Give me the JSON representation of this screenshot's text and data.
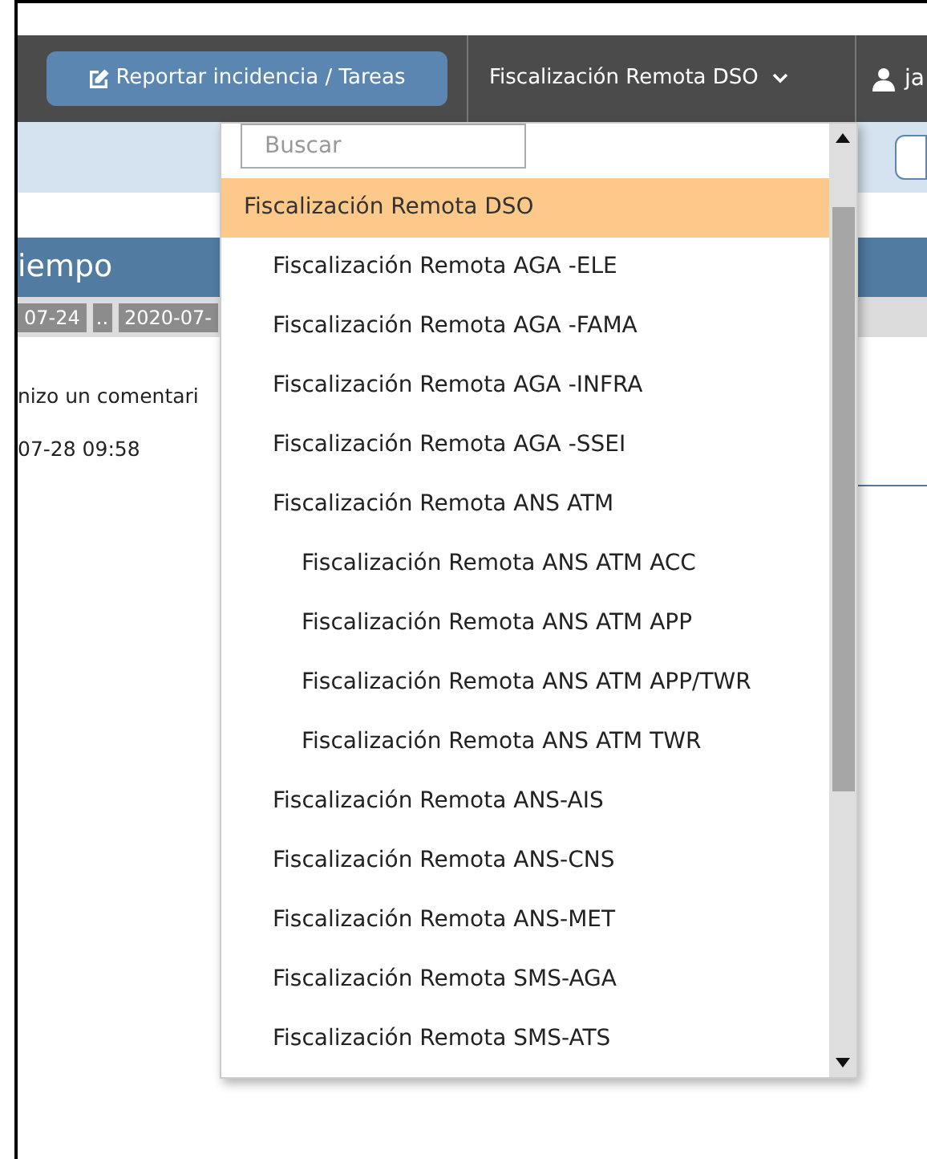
{
  "navbar": {
    "report_button": "Reportar incidencia / Tareas",
    "dropdown": "Fiscalización Remota DSO",
    "user": "ja"
  },
  "panel": {
    "title": "iempo",
    "dates": [
      "07-24",
      "..",
      "2020-07-"
    ],
    "comment": "nizo un comentari",
    "time": "07-28 09:58"
  },
  "menu": {
    "search": {
      "placeholder": "Buscar"
    },
    "items": [
      {
        "label": "Fiscalización Remota DSO",
        "selected": true
      },
      {
        "label": "Fiscalización Remota AGA -ELE",
        "selected": false
      },
      {
        "label": "Fiscalización Remota AGA -FAMA",
        "selected": false
      },
      {
        "label": "Fiscalización Remota AGA -INFRA",
        "selected": false
      },
      {
        "label": "Fiscalización Remota AGA -SSEI",
        "selected": false
      },
      {
        "label": "Fiscalización Remota ANS ATM",
        "selected": false,
        "children": [
          {
            "label": "Fiscalización Remota ANS ATM ACC",
            "selected": false
          },
          {
            "label": "Fiscalización Remota ANS ATM APP",
            "selected": false
          },
          {
            "label": "Fiscalización Remota ANS ATM APP/TWR",
            "selected": false
          },
          {
            "label": "Fiscalización Remota ANS ATM TWR",
            "selected": false
          }
        ]
      },
      {
        "label": "Fiscalización Remota ANS-AIS",
        "selected": false
      },
      {
        "label": "Fiscalización Remota ANS-CNS",
        "selected": false
      },
      {
        "label": "Fiscalización Remota ANS-MET",
        "selected": false
      },
      {
        "label": "Fiscalización Remota SMS-AGA",
        "selected": false
      },
      {
        "label": "Fiscalización Remota SMS-ATS",
        "selected": false
      }
    ]
  }
}
